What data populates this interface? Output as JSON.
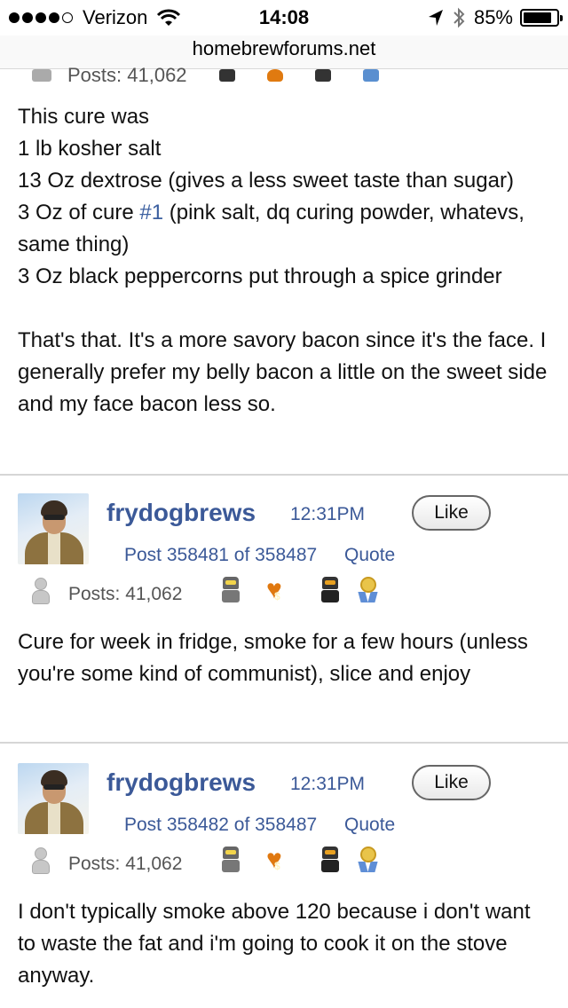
{
  "status_bar": {
    "carrier": "Verizon",
    "time": "14:08",
    "battery": "85%",
    "battery_level": 0.85
  },
  "url_bar": {
    "domain": "homebrewforums.net"
  },
  "cut_post": {
    "posts_count": "Posts: 41,062",
    "lines": [
      "This cure was",
      "1 lb kosher salt",
      "13 Oz dextrose (gives a less sweet taste than sugar)",
      {
        "before": "3 Oz of cure ",
        "link": "#1",
        "after": " (pink salt, dq curing powder, whatevs, same thing)"
      },
      "3 Oz black peppercorns put through a spice grinder",
      "",
      "That's that. It's a more savory bacon since it's the face. I generally prefer my belly bacon a little on the sweet side and my face bacon less so."
    ]
  },
  "posts": [
    {
      "username": "frydogbrews",
      "time": "12:31PM",
      "like_label": "Like",
      "post_number": "Post 358481 of 358487",
      "quote_label": "Quote",
      "posts_count": "Posts: 41,062",
      "body": "Cure for week in fridge, smoke for a few hours (unless you're some kind of communist), slice and enjoy"
    },
    {
      "username": "frydogbrews",
      "time": "12:31PM",
      "like_label": "Like",
      "post_number": "Post 358482 of 358487",
      "quote_label": "Quote",
      "posts_count": "Posts: 41,062",
      "body": "I don't typically smoke above 120 because i don't want to waste the fat and i'm going to cook it on the stove anyway."
    }
  ],
  "colors": {
    "link": "#3b5998",
    "inline_link": "#3b5fa0",
    "divider": "#d6d6d6",
    "heart_badge": "#e0780f"
  },
  "icons": [
    "signal-dots-icon",
    "wifi-icon",
    "location-arrow-icon",
    "bluetooth-icon",
    "battery-icon",
    "user-silhouette-icon",
    "robot-badge-icon",
    "heart-dollar-badge-icon",
    "dark-robot-badge-icon",
    "medal-badge-icon"
  ]
}
